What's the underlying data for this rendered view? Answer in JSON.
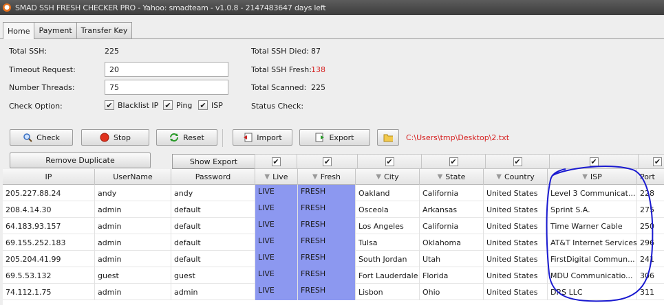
{
  "window": {
    "title": "SMAD SSH FRESH CHECKER PRO - Yahoo: smadteam - v1.0.8 - 2147483647 days left"
  },
  "tabs": [
    {
      "label": "Home"
    },
    {
      "label": "Payment"
    },
    {
      "label": "Transfer Key"
    }
  ],
  "stats": {
    "total_ssh_label": "Total SSH:",
    "total_ssh_value": "225",
    "timeout_label": "Timeout Request:",
    "timeout_value": "20",
    "threads_label": "Number Threads:",
    "threads_value": "75",
    "check_option_label": "Check Option:",
    "died_label": "Total SSH Died:",
    "died_value": "87",
    "fresh_label": "Total SSH Fresh:",
    "fresh_value": "138",
    "scanned_label": "Total Scanned:",
    "scanned_value": "225",
    "status_label": "Status Check:"
  },
  "options": [
    {
      "label": "Blacklist IP",
      "checked": true
    },
    {
      "label": "Ping",
      "checked": true
    },
    {
      "label": "ISP",
      "checked": true
    }
  ],
  "toolbar": {
    "check": "Check",
    "stop": "Stop",
    "reset": "Reset",
    "import": "Import",
    "export": "Export",
    "path": "C:\\Users\\tmp\\Desktop\\2.txt"
  },
  "controls": {
    "remove_duplicate": "Remove Duplicate",
    "show_export": "Show Export"
  },
  "columns": [
    "IP",
    "UserName",
    "Password",
    "Live",
    "Fresh",
    "City",
    "State",
    "Country",
    "ISP",
    "Port"
  ],
  "rows": [
    [
      "205.227.88.24",
      "andy",
      "andy",
      "LIVE",
      "FRESH",
      "Oakland",
      "California",
      "United States",
      "Level 3 Communicat...",
      "228"
    ],
    [
      "208.4.14.30",
      "admin",
      "default",
      "LIVE",
      "FRESH",
      "Osceola",
      "Arkansas",
      "United States",
      "Sprint S.A.",
      "275"
    ],
    [
      "64.183.93.157",
      "admin",
      "default",
      "LIVE",
      "FRESH",
      "Los Angeles",
      "California",
      "United States",
      "Time Warner Cable",
      "250"
    ],
    [
      "69.155.252.183",
      "admin",
      "default",
      "LIVE",
      "FRESH",
      "Tulsa",
      "Oklahoma",
      "United States",
      "AT&T Internet Services",
      "296"
    ],
    [
      "205.204.41.99",
      "admin",
      "default",
      "LIVE",
      "FRESH",
      "South Jordan",
      "Utah",
      "United States",
      "FirstDigital Commun...",
      "241"
    ],
    [
      "69.5.53.132",
      "guest",
      "guest",
      "LIVE",
      "FRESH",
      "Fort Lauderdale",
      "Florida",
      "United States",
      "MDU Communicatio...",
      "306"
    ],
    [
      "74.112.1.75",
      "admin",
      "admin",
      "LIVE",
      "FRESH",
      "Lisbon",
      "Ohio",
      "United States",
      "DRS LLC",
      "311"
    ]
  ],
  "colors": {
    "highlight": "#8c98f0",
    "accent_red": "#d62020",
    "annotation": "#1a1ad0"
  }
}
